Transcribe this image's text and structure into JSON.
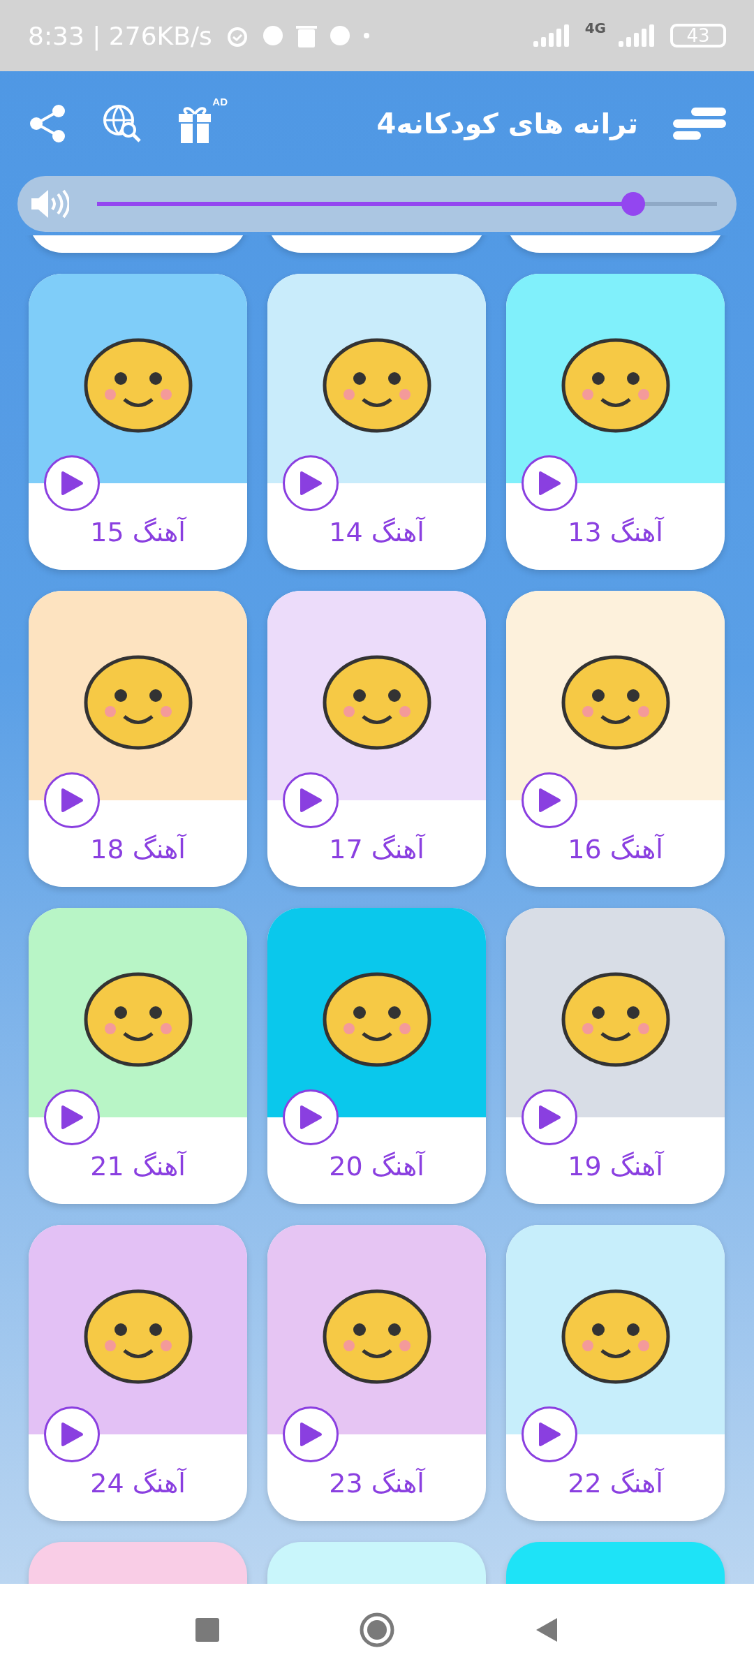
{
  "status_bar": {
    "time": "8:33 | 276KB/s",
    "network": "4G",
    "battery": "43"
  },
  "header": {
    "title": "ترانه های کودکانه4",
    "ad_badge": "AD"
  },
  "volume": {
    "level": 0.865
  },
  "cut_top_cards": [
    {
      "color": "#ffffff"
    },
    {
      "color": "#ffffff"
    },
    {
      "color": "#ffffff"
    }
  ],
  "songs": [
    {
      "label": "آهنگ 13",
      "color": "#80f0fb"
    },
    {
      "label": "آهنگ 14",
      "color": "#c9ecfb"
    },
    {
      "label": "آهنگ 15",
      "color": "#7fcdf9"
    },
    {
      "label": "آهنگ 16",
      "color": "#fdf1dc"
    },
    {
      "label": "آهنگ 17",
      "color": "#ecdcfa"
    },
    {
      "label": "آهنگ 18",
      "color": "#fde3c0"
    },
    {
      "label": "آهنگ 19",
      "color": "#d8dde6"
    },
    {
      "label": "آهنگ 20",
      "color": "#0ac8ec"
    },
    {
      "label": "آهنگ 21",
      "color": "#b8f5c6"
    },
    {
      "label": "آهنگ 22",
      "color": "#c7eefb"
    },
    {
      "label": "آهنگ 23",
      "color": "#e6c5f3"
    },
    {
      "label": "آهنگ 24",
      "color": "#e3c1f5"
    }
  ],
  "cut_bottom_cards": [
    {
      "color": "#1ee3f7"
    },
    {
      "color": "#c9f6fb"
    },
    {
      "color": "#f9cde6"
    }
  ]
}
